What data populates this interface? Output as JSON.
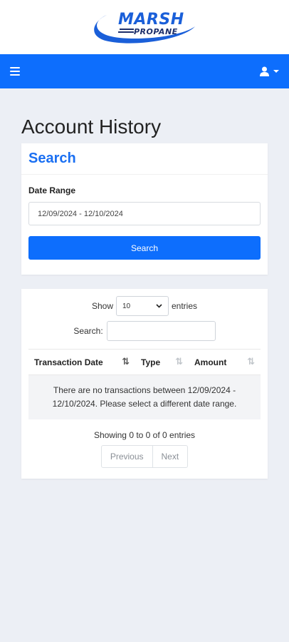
{
  "brand": {
    "logo_top": "MARSH",
    "logo_bottom": "PROPANE",
    "primary_color": "#0d6efd",
    "logo_blue": "#1a5fd9"
  },
  "navbar": {
    "menu_icon": "hamburger-icon",
    "user_icon": "user-icon"
  },
  "page": {
    "title": "Account History"
  },
  "search": {
    "heading": "Search",
    "date_range_label": "Date Range",
    "date_range_value": "12/09/2024 - 12/10/2024",
    "button_label": "Search"
  },
  "table": {
    "show_label": "Show",
    "entries_label": "entries",
    "page_length": "10",
    "filter_label": "Search:",
    "filter_value": "",
    "columns": [
      "Transaction Date",
      "Type",
      "Amount"
    ],
    "empty_message": "There are no transactions between 12/09/2024 - 12/10/2024. Please select a different date range.",
    "info": "Showing 0 to 0 of 0 entries",
    "previous_label": "Previous",
    "next_label": "Next"
  }
}
